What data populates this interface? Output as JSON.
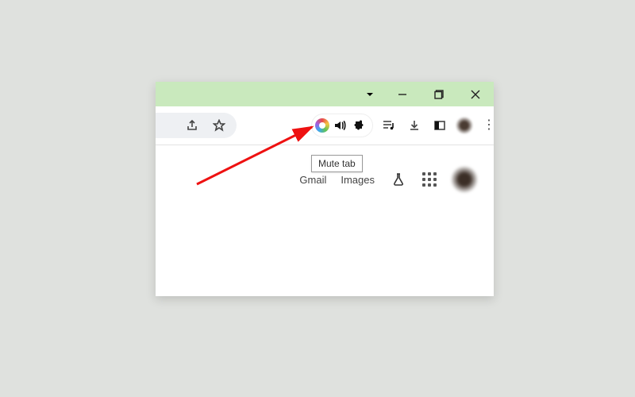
{
  "window_controls": {},
  "toolbar": {},
  "tooltip": {
    "mute_tab": "Mute tab"
  },
  "content": {
    "gmail": "Gmail",
    "images": "Images"
  }
}
